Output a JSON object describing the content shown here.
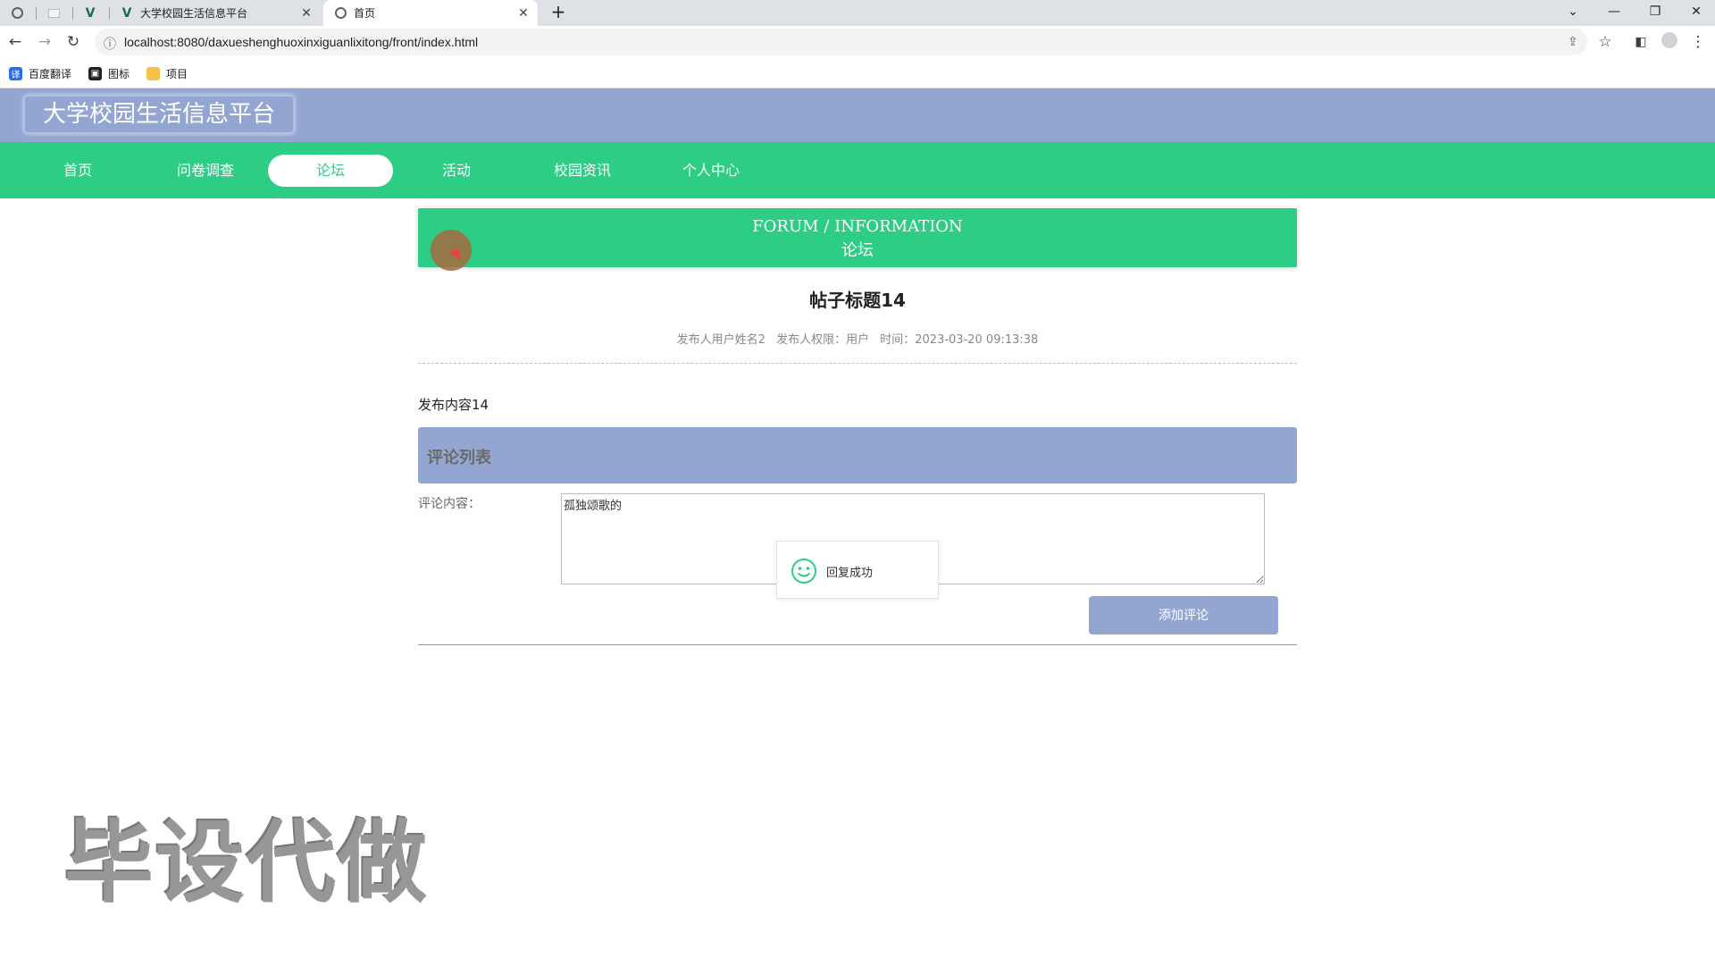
{
  "browser": {
    "tabs": [
      {
        "title": "",
        "icon": "globe-icon"
      },
      {
        "title": "",
        "icon": "blank-page-icon"
      },
      {
        "title": "",
        "icon": "vue-logo-icon"
      },
      {
        "title": "大学校园生活信息平台",
        "icon": "vue-logo-icon"
      },
      {
        "title": "首页",
        "icon": "globe-icon"
      }
    ],
    "url": "localhost:8080/daxueshenghuoxinxiguanlixitong/front/index.html",
    "bookmarks": [
      {
        "label": "百度翻译",
        "icon": "translate-icon",
        "color": "#2a6ee8"
      },
      {
        "label": "图标",
        "icon": "image-icon",
        "color": "#202124"
      },
      {
        "label": "项目",
        "icon": "folder-icon",
        "color": "#f5c24a"
      }
    ]
  },
  "site": {
    "title": "大学校园生活信息平台",
    "nav": [
      {
        "label": "首页",
        "active": false
      },
      {
        "label": "问卷调查",
        "active": false
      },
      {
        "label": "论坛",
        "active": true
      },
      {
        "label": "活动",
        "active": false
      },
      {
        "label": "校园资讯",
        "active": false
      },
      {
        "label": "个人中心",
        "active": false
      }
    ]
  },
  "banner": {
    "english": "FORUM / INFORMATION",
    "chinese": "论坛"
  },
  "post": {
    "title": "帖子标题14",
    "author": "发布人用户姓名2",
    "role": "发布人权限：用户",
    "time": "时间：2023-03-20 09:13:38",
    "content": "发布内容14"
  },
  "comments": {
    "header": "评论列表",
    "field_label": "评论内容：",
    "field_value": "孤独颂歌的",
    "submit_label": "添加评论"
  },
  "toast": {
    "message": "回复成功",
    "icon": "smiley-icon"
  },
  "watermark": "毕设代做",
  "colors": {
    "header": "#93a6d2",
    "nav": "#2ecd85",
    "accent": "#2ecd85"
  }
}
